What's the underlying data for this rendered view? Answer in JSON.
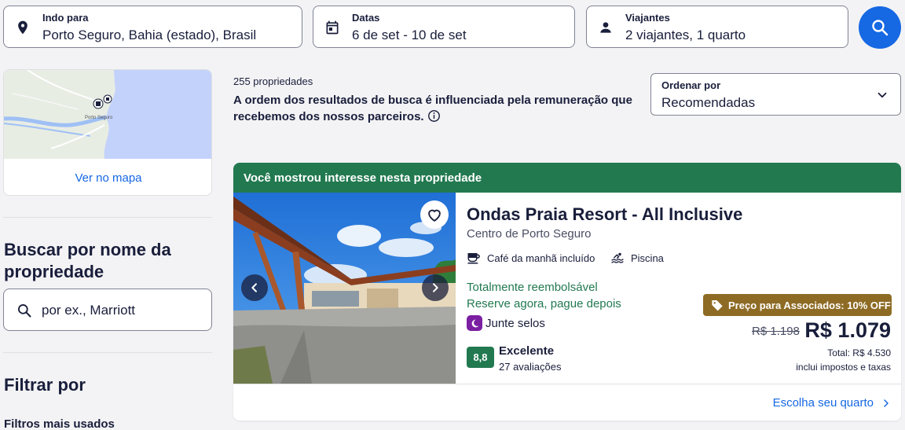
{
  "search": {
    "destination": {
      "label": "Indo para",
      "value": "Porto Seguro, Bahia (estado), Brasil",
      "icon": "location-pin-icon"
    },
    "dates": {
      "label": "Datas",
      "value": "6 de set - 10 de set",
      "icon": "calendar-icon"
    },
    "travelers": {
      "label": "Viajantes",
      "value": "2 viajantes, 1 quarto",
      "icon": "person-icon"
    },
    "search_icon": "search-icon"
  },
  "sidebar": {
    "map_link": "Ver no mapa",
    "map_label": "Porto Seguro",
    "name_search": {
      "heading": "Buscar por nome da propriedade",
      "placeholder": "por ex., Marriott"
    },
    "filter_heading": "Filtrar por",
    "popular_filters": "Filtros mais usados"
  },
  "results": {
    "count": "255 propriedades",
    "disclaimer": "A ordem dos resultados de busca é influenciada pela remuneração que recebemos dos nossos parceiros.",
    "sort": {
      "label": "Ordenar por",
      "value": "Recomendadas"
    }
  },
  "property": {
    "banner": "Você mostrou interesse nesta propriedade",
    "name": "Ondas Praia Resort - All Inclusive",
    "location": "Centro de Porto Seguro",
    "amenities": [
      {
        "label": "Café da manhã incluído",
        "icon": "coffee-cup-icon"
      },
      {
        "label": "Piscina",
        "icon": "pool-icon"
      }
    ],
    "refundable": "Totalmente reembolsável",
    "pay_later": "Reserve agora, pague depois",
    "stamps": "Junte selos",
    "score": "8,8",
    "rating_label": "Excelente",
    "reviews": "27 avaliações",
    "member_badge": "Preço para Associados: 10% OFF",
    "old_price": "R$ 1.198",
    "price": "R$ 1.079",
    "total": "Total: R$ 4.530",
    "taxes": "inclui impostos e taxas",
    "cta": "Escolha seu quarto"
  },
  "colors": {
    "accent": "#1668e3",
    "banner_green": "#227950",
    "member_gold": "#8e6b25",
    "stamps_purple": "#7b1fa2"
  }
}
